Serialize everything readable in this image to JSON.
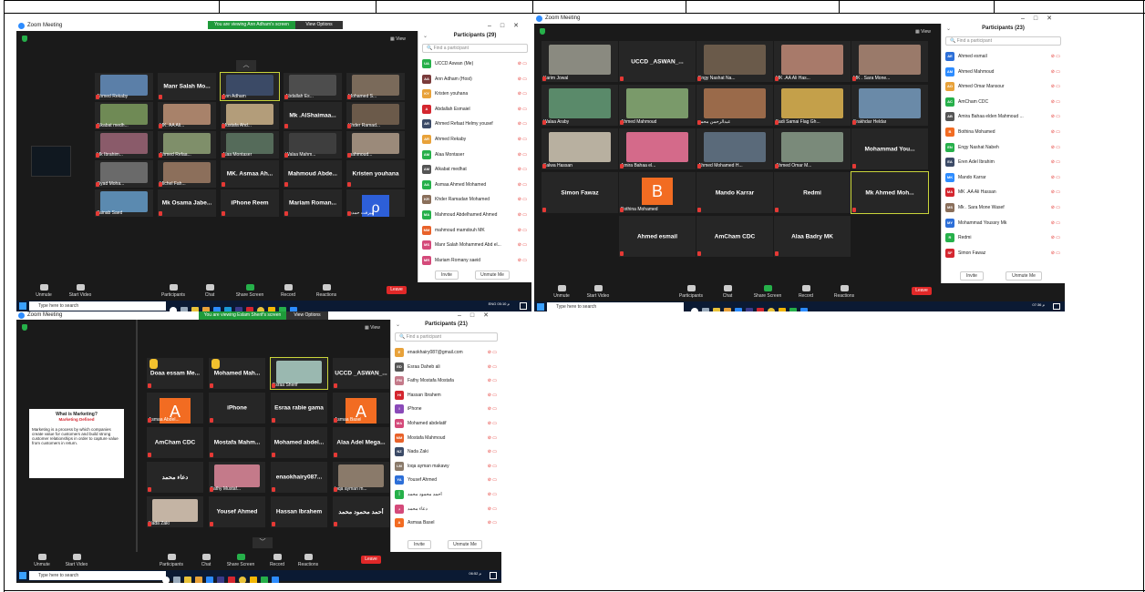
{
  "colors": {
    "zoom_blue": "#2d8cff",
    "green": "#26b04a",
    "red": "#e02828",
    "tile": "#262626",
    "taskbar": "#0b1a33"
  },
  "screen1": {
    "title": "Zoom Meeting",
    "banner": "You are viewing Ann Adham's screen",
    "view_options": "View Options",
    "view": "View",
    "tiles": [
      {
        "name": "Ahmed Rekaby",
        "type": "photo",
        "color": "#5b7fa8"
      },
      {
        "name": "Manr Salah Mo...",
        "type": "name"
      },
      {
        "name": "Ann Adham",
        "type": "photo",
        "color": "#3b4a66",
        "active": true
      },
      {
        "name": "Abdallah Es...",
        "type": "photo",
        "color": "#4d4d4d"
      },
      {
        "name": "Mohamed S...",
        "type": "photo",
        "color": "#7a6a5a"
      },
      {
        "name": "Alkabat medh...",
        "type": "photo",
        "color": "#6f8a55"
      },
      {
        "name": "MK. AA Ali...",
        "type": "photo",
        "color": "#a8826a"
      },
      {
        "name": "Mustafa Ahd...",
        "type": "photo",
        "color": "#b39d7a"
      },
      {
        "name": "Mk .AlShaimaa...",
        "type": "name"
      },
      {
        "name": "Khder Ramad...",
        "type": "photo",
        "color": "#6b5a4a"
      },
      {
        "name": "Mk Ibrahim...",
        "type": "photo",
        "color": "#8a5b6a"
      },
      {
        "name": "Ahmed Refaa...",
        "type": "photo",
        "color": "#7f8f6a"
      },
      {
        "name": "Alaa Montaser",
        "type": "photo",
        "color": "#556b5a"
      },
      {
        "name": "Walaa Mahm...",
        "type": "photo",
        "color": "#3e3e3e"
      },
      {
        "name": "mahmoud...",
        "type": "photo",
        "color": "#9b8a7a"
      },
      {
        "name": "Ziyad Moha...",
        "type": "photo",
        "color": "#6a6a6a"
      },
      {
        "name": "Michel Fah...",
        "type": "photo",
        "color": "#8c6f5b"
      },
      {
        "name": "MK. Asmaa Ah...",
        "type": "name"
      },
      {
        "name": "Mahmoud Abde...",
        "type": "name"
      },
      {
        "name": "Kristen youhana",
        "type": "name"
      },
      {
        "name": "Zainab Saed",
        "type": "photo",
        "color": "#5b8ab0"
      },
      {
        "name": "Mk Osama Jabe...",
        "type": "name"
      },
      {
        "name": "iPhone Reem",
        "type": "name"
      },
      {
        "name": "Mariam Roman...",
        "type": "name"
      },
      {
        "name": "ميرفت حمدي",
        "type": "ptile"
      }
    ],
    "panel_title": "Participants (29)",
    "search_placeholder": "Find a participant",
    "participants": [
      {
        "initials": "UA",
        "name": "UCCD Aswan (Me)",
        "color": "#26b04a"
      },
      {
        "initials": "AA",
        "name": "Ann Adham (Host)",
        "color": "#7a3b3b"
      },
      {
        "initials": "KY",
        "name": "Kristen youhana",
        "color": "#e8a23a"
      },
      {
        "initials": "A",
        "name": "Abdallah Esmaiel",
        "color": "#d4262f"
      },
      {
        "initials": "AR",
        "name": "Ahmed Refaat Helmy yousef",
        "color": "#3b4a66"
      },
      {
        "initials": "AR",
        "name": "Ahmed Rekaby",
        "color": "#e8a23a"
      },
      {
        "initials": "AM",
        "name": "Alaa Montaser",
        "color": "#26b04a"
      },
      {
        "initials": "AM",
        "name": "Alkabat medhat",
        "color": "#555555"
      },
      {
        "initials": "AA",
        "name": "Asmaa Ahmed Mohamed",
        "color": "#26b04a"
      },
      {
        "initials": "KR",
        "name": "Khder Ramadan Mohamed",
        "color": "#8a6f5b"
      },
      {
        "initials": "MA",
        "name": "Mahmoud Abdelhamed Ahmed",
        "color": "#26b04a"
      },
      {
        "initials": "MM",
        "name": "mahmoud mamdouh MK",
        "color": "#e8622a"
      },
      {
        "initials": "MS",
        "name": "Manr Salah Mohammed Abd el...",
        "color": "#d44a7a"
      },
      {
        "initials": "MR",
        "name": "Mariam Romany saeid",
        "color": "#d44a7a"
      }
    ],
    "invite": "Invite",
    "unmute_me": "Unmute Me",
    "toolbar": [
      "Unmute",
      "Start Video",
      "Participants",
      "Chat",
      "Share Screen",
      "Record",
      "Reactions"
    ],
    "leave": "Leave",
    "taskbar_search": "Type here to search",
    "clock": "05:10 م",
    "lang": "ENG"
  },
  "screen2": {
    "title": "Zoom Meeting",
    "view": "View",
    "tiles": [
      {
        "name": "Karim Jowal",
        "type": "photo",
        "color": "#8a8a80"
      },
      {
        "name": "UCCD _ASWAN_...",
        "type": "name"
      },
      {
        "name": "Engy Nashat Na...",
        "type": "photo",
        "color": "#6a5a4a"
      },
      {
        "name": "MK .AA Ali Has...",
        "type": "photo",
        "color": "#a87a6a"
      },
      {
        "name": "MK . Sara Mone...",
        "type": "photo",
        "color": "#9a7a6a"
      },
      {
        "name": "Walaa Araby",
        "type": "photo",
        "color": "#5a8a6a"
      },
      {
        "name": "Ahmed Mahmoud",
        "type": "photo",
        "color": "#7a9a6a"
      },
      {
        "name": "عبدالرحمن محمد",
        "type": "photo",
        "color": "#9a6a4a"
      },
      {
        "name": "Fadi Samai Flag Gh...",
        "type": "photo",
        "color": "#c4a04a"
      },
      {
        "name": "Erakhdar Heldar",
        "type": "photo",
        "color": "#6a8aa8"
      },
      {
        "name": "Salwa Hassan",
        "type": "photo",
        "color": "#b8b0a0"
      },
      {
        "name": "Amira Bahaa el...",
        "type": "photo",
        "color": "#d46a8a"
      },
      {
        "name": "Ahmed Mohamed H...",
        "type": "photo",
        "color": "#5a6a7a"
      },
      {
        "name": "Ahmed Omar M...",
        "type": "photo",
        "color": "#7a8a7a"
      },
      {
        "name": "Mohammad You...",
        "type": "name"
      },
      {
        "name": "Simon Fawaz",
        "type": "name"
      },
      {
        "name": "Bothina Mohamed",
        "type": "letter",
        "letter": "B"
      },
      {
        "name": "Mando Karrar",
        "type": "name"
      },
      {
        "name": "Redmi",
        "type": "name"
      },
      {
        "name": "Mk Ahmed Moh...",
        "type": "name",
        "active": true
      },
      {
        "name": "Ahmed esmail",
        "type": "name"
      },
      {
        "name": "AmCham CDC",
        "type": "name"
      },
      {
        "name": "Alaa Badry MK",
        "type": "name"
      }
    ],
    "panel_title": "Participants (23)",
    "search_placeholder": "Find a participant",
    "participants": [
      {
        "initials": "AE",
        "name": "Ahmed esmail",
        "color": "#2d6fd8"
      },
      {
        "initials": "AM",
        "name": "Ahmed Mahmoud",
        "color": "#2d8cff"
      },
      {
        "initials": "AO",
        "name": "Ahmed Omar Mansour",
        "color": "#e8a23a"
      },
      {
        "initials": "AC",
        "name": "AmCham CDC",
        "color": "#26b04a"
      },
      {
        "initials": "AB",
        "name": "Amira Bahaa elden Mahmoud ...",
        "color": "#555555"
      },
      {
        "initials": "B",
        "name": "Bothina Mohamed",
        "color": "#f26c22"
      },
      {
        "initials": "EN",
        "name": "Engy Nashat Nabeh",
        "color": "#26b04a"
      },
      {
        "initials": "EA",
        "name": "Eren Adel Ibrahim",
        "color": "#3b4a66"
      },
      {
        "initials": "MK",
        "name": "Mando Karrar",
        "color": "#2d8cff"
      },
      {
        "initials": "MA",
        "name": "MK .AA Ali Hassan",
        "color": "#d4262f"
      },
      {
        "initials": "MS",
        "name": "Mk . Sara Mone Wasef",
        "color": "#8a6f5b"
      },
      {
        "initials": "MY",
        "name": "Mohammad Youssry Mk",
        "color": "#2d6fd8"
      },
      {
        "initials": "R",
        "name": "Redmi",
        "color": "#26b04a"
      },
      {
        "initials": "SF",
        "name": "Simon Fawaz",
        "color": "#d4262f"
      }
    ],
    "invite": "Invite",
    "unmute_me": "Unmute Me",
    "toolbar": [
      "Unmute",
      "Start Video",
      "Participants",
      "Chat",
      "Share Screen",
      "Record",
      "Reactions"
    ],
    "leave": "Leave",
    "taskbar_search": "Type here to search",
    "clock": "07:36 م"
  },
  "screen3": {
    "title": "Zoom Meeting",
    "banner": "You are viewing Eslam Sherif's screen",
    "view_options": "View Options",
    "view": "View",
    "slide": {
      "title": "What is Marketing?",
      "subtitle": "Marketing Defined",
      "body": "Marketing is a process by which companies create value for customers and build strong customer relationships in order to capture value from customers in return."
    },
    "tiles": [
      {
        "name": "Doaa essam Me...",
        "type": "name",
        "hand": true
      },
      {
        "name": "Mohamed Mah...",
        "type": "name",
        "hand": true
      },
      {
        "name": "Esraa Sherif",
        "type": "photo",
        "color": "#9ab8b0",
        "active": true
      },
      {
        "name": "UCCD _ASWAN_...",
        "type": "name"
      },
      {
        "name": "Asmaa Abdel...",
        "type": "letter",
        "letter": "A"
      },
      {
        "name": "iPhone",
        "type": "name"
      },
      {
        "name": "Esraa rabie gama",
        "type": "name"
      },
      {
        "name": "Asmaa Basel",
        "type": "letter",
        "letter": "A"
      },
      {
        "name": "AmCham CDC",
        "type": "name"
      },
      {
        "name": "Mostafa Mahm...",
        "type": "name"
      },
      {
        "name": "Mohamed abdel...",
        "type": "name"
      },
      {
        "name": "Alaa Adel Mega...",
        "type": "name"
      },
      {
        "name": "دعاء محمد",
        "type": "name"
      },
      {
        "name": "Fathy Mustaf...",
        "type": "photo",
        "color": "#c47a8a"
      },
      {
        "name": "enaokhairy087...",
        "type": "name"
      },
      {
        "name": "loqa ayman m...",
        "type": "photo",
        "color": "#8a7a6a"
      },
      {
        "name": "Nada Zaki",
        "type": "photo",
        "color": "#c4b4a4"
      },
      {
        "name": "Yousef Ahmed",
        "type": "name"
      },
      {
        "name": "Hassan Ibrahem",
        "type": "name"
      },
      {
        "name": "أحمد محمود محمد",
        "type": "name"
      }
    ],
    "panel_title": "Participants (21)",
    "search_placeholder": "Find a participant",
    "participants": [
      {
        "initials": "E",
        "name": "enaokhairy087@gmail.com",
        "color": "#e8a23a"
      },
      {
        "initials": "ED",
        "name": "Esraa Daheb ali",
        "color": "#555555"
      },
      {
        "initials": "FM",
        "name": "Fathy Mostafa Mostafa",
        "color": "#c47a8a"
      },
      {
        "initials": "HI",
        "name": "Hassan Ibrahem",
        "color": "#d4262f"
      },
      {
        "initials": "I",
        "name": "iPhone",
        "color": "#8a4ab8"
      },
      {
        "initials": "MA",
        "name": "Mohamed abdelatif",
        "color": "#d44a7a"
      },
      {
        "initials": "MM",
        "name": "Mostafa Mahmoud",
        "color": "#e8622a"
      },
      {
        "initials": "NZ",
        "name": "Nada Zaki",
        "color": "#3b4a66"
      },
      {
        "initials": "LM",
        "name": "loqa ayman makawy",
        "color": "#8a7a6a"
      },
      {
        "initials": "YA",
        "name": "Yousef Ahmed",
        "color": "#2d6fd8"
      },
      {
        "initials": "أ",
        "name": "أحمد محمود محمد",
        "color": "#26b04a"
      },
      {
        "initials": "د",
        "name": "دعاء محمد",
        "color": "#d44a7a"
      },
      {
        "initials": "A",
        "name": "Asmaa Basel",
        "color": "#f26c22"
      }
    ],
    "invite": "Invite",
    "unmute_me": "Unmute Me",
    "toolbar": [
      "Unmute",
      "Start Video",
      "Participants",
      "Chat",
      "Share Screen",
      "Record",
      "Reactions"
    ],
    "leave": "Leave",
    "taskbar_search": "Type here to search",
    "clock": "06:52 م"
  }
}
